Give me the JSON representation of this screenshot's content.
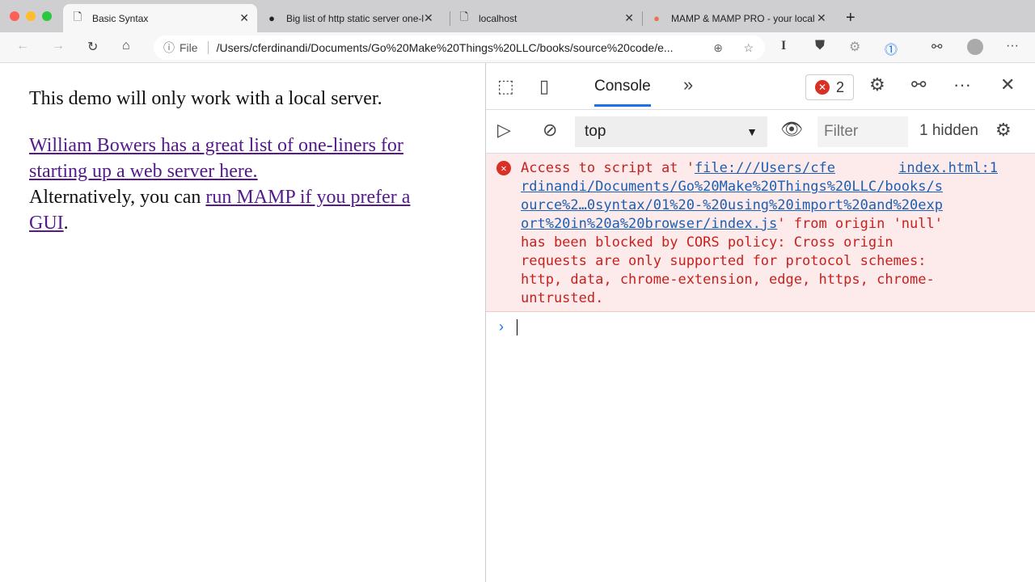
{
  "tabs": [
    {
      "title": "Basic Syntax",
      "icon": "document-icon",
      "active": true
    },
    {
      "title": "Big list of http static server one-liners",
      "icon": "github-icon"
    },
    {
      "title": "localhost",
      "icon": "document-icon"
    },
    {
      "title": "MAMP & MAMP PRO - your local",
      "icon": "mamp-icon"
    }
  ],
  "toolbar": {
    "file_label": "File",
    "url": "/Users/cferdinandi/Documents/Go%20Make%20Things%20LLC/books/source%20code/e..."
  },
  "page": {
    "line1": "This demo will only work with a local server.",
    "link1": "William Bowers has a great list of one-liners for starting up a web server here.",
    "text2": "Alternatively, you can ",
    "link2": "run MAMP if you prefer a GUI",
    "period": "."
  },
  "devtools": {
    "console_tab": "Console",
    "error_count": "2",
    "context": "top",
    "filter_placeholder": "Filter",
    "hidden": "1 hidden",
    "error": {
      "prefix": "Access to script at '",
      "source": "index.html:1",
      "url_lines": [
        "file:///Users/cfe",
        "rdinandi/Documents/Go%20Make%20Things%20LLC/books/s",
        "ource%2…0syntax/01%20-%20using%20import%20and%20exp",
        "ort%20in%20a%20browser/index.js"
      ],
      "after_url": "' from origin 'null'",
      "lines": [
        "has been blocked by CORS policy: Cross origin",
        "requests are only supported for protocol schemes:",
        "http, data, chrome-extension, edge, https, chrome-",
        "untrusted."
      ]
    }
  }
}
